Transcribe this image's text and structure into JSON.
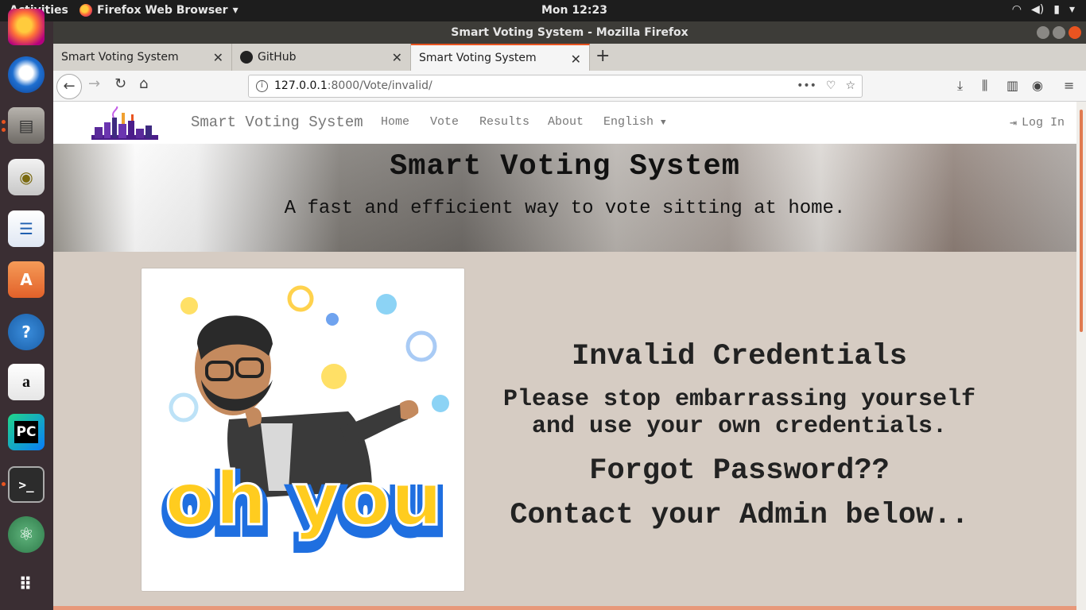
{
  "topbar": {
    "activities": "Activities",
    "app_name": "Firefox Web Browser",
    "clock": "Mon 12:23"
  },
  "window": {
    "title": "Smart Voting System - Mozilla Firefox"
  },
  "tabs": [
    {
      "label": "Smart Voting System"
    },
    {
      "label": "GitHub"
    },
    {
      "label": "Smart Voting System"
    }
  ],
  "urlbar": {
    "host": "127.0.0.1",
    "path": ":8000/Vote/invalid/"
  },
  "site": {
    "brand": "Smart Voting System",
    "menu": [
      "Home",
      "Vote",
      "Results",
      "About",
      "English"
    ],
    "login": "Log In"
  },
  "hero": {
    "title": "Smart Voting System",
    "subtitle": "A fast and efficient way to vote sitting at home."
  },
  "image": {
    "text": "oh you"
  },
  "message": {
    "heading": "Invalid Credentials",
    "line1": "Please stop embarrassing yourself",
    "line2": "and use your own credentials.",
    "forgot": "Forgot Password??",
    "contact": "Contact your Admin below.."
  },
  "colors": {
    "ubuntu_orange": "#e95420",
    "page_bg": "#d6ccc3",
    "launcher_bg": "#3a2e33"
  },
  "icons": {
    "launcher": [
      "firefox-icon",
      "thunderbird-icon",
      "files-icon",
      "rhythmbox-icon",
      "writer-icon",
      "software-icon",
      "help-icon",
      "amazon-icon",
      "pycharm-icon",
      "terminal-icon",
      "atom-icon",
      "apps-grid-icon"
    ]
  }
}
